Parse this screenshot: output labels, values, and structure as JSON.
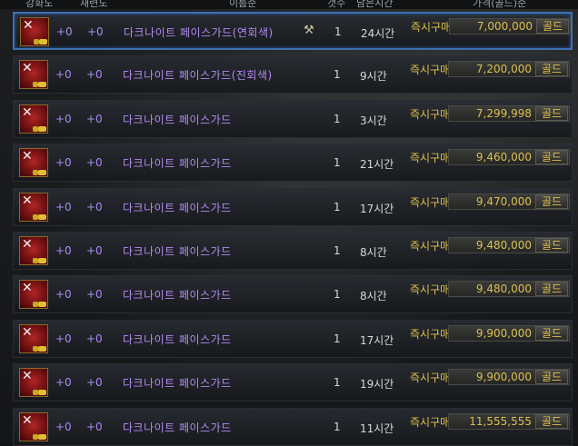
{
  "header": {
    "columns": [
      "강화도",
      "재련도",
      "이름순",
      "갯수",
      "남은시간",
      "가격(골드)순"
    ]
  },
  "rows": [
    {
      "upgrade": "+0",
      "refine": "+0",
      "name": "다크나이트 페이스가드(연회색)",
      "qty": "1",
      "time": "24시간",
      "buy": "즉시구매",
      "price": "7,000,000",
      "unit": "골드",
      "selected": true,
      "tool": true
    },
    {
      "upgrade": "+0",
      "refine": "+0",
      "name": "다크나이트 페이스가드(진회색)",
      "qty": "1",
      "time": "9시간",
      "buy": "즉시구매",
      "price": "7,200,000",
      "unit": "골드",
      "selected": false,
      "tool": false
    },
    {
      "upgrade": "+0",
      "refine": "+0",
      "name": "다크나이트 페이스가드",
      "qty": "1",
      "time": "3시간",
      "buy": "즉시구매",
      "price": "7,299,998",
      "unit": "골드",
      "selected": false,
      "tool": false
    },
    {
      "upgrade": "+0",
      "refine": "+0",
      "name": "다크나이트 페이스가드",
      "qty": "1",
      "time": "21시간",
      "buy": "즉시구매",
      "price": "9,460,000",
      "unit": "골드",
      "selected": false,
      "tool": false
    },
    {
      "upgrade": "+0",
      "refine": "+0",
      "name": "다크나이트 페이스가드",
      "qty": "1",
      "time": "17시간",
      "buy": "즉시구매",
      "price": "9,470,000",
      "unit": "골드",
      "selected": false,
      "tool": false
    },
    {
      "upgrade": "+0",
      "refine": "+0",
      "name": "다크나이트 페이스가드",
      "qty": "1",
      "time": "8시간",
      "buy": "즉시구매",
      "price": "9,480,000",
      "unit": "골드",
      "selected": false,
      "tool": false
    },
    {
      "upgrade": "+0",
      "refine": "+0",
      "name": "다크나이트 페이스가드",
      "qty": "1",
      "time": "8시간",
      "buy": "즉시구매",
      "price": "9,480,000",
      "unit": "골드",
      "selected": false,
      "tool": false
    },
    {
      "upgrade": "+0",
      "refine": "+0",
      "name": "다크나이트 페이스가드",
      "qty": "1",
      "time": "17시간",
      "buy": "즉시구매",
      "price": "9,900,000",
      "unit": "골드",
      "selected": false,
      "tool": false
    },
    {
      "upgrade": "+0",
      "refine": "+0",
      "name": "다크나이트 페이스가드",
      "qty": "1",
      "time": "19시간",
      "buy": "즉시구매",
      "price": "9,900,000",
      "unit": "골드",
      "selected": false,
      "tool": false
    },
    {
      "upgrade": "+0",
      "refine": "+0",
      "name": "다크나이트 페이스가드",
      "qty": "1",
      "time": "11시간",
      "buy": "즉시구매",
      "price": "11,555,555",
      "unit": "골드",
      "selected": false,
      "tool": false
    }
  ],
  "colors": {
    "name": "#b48af0",
    "price": "#d9c050",
    "selection": "#3d6fb0"
  }
}
